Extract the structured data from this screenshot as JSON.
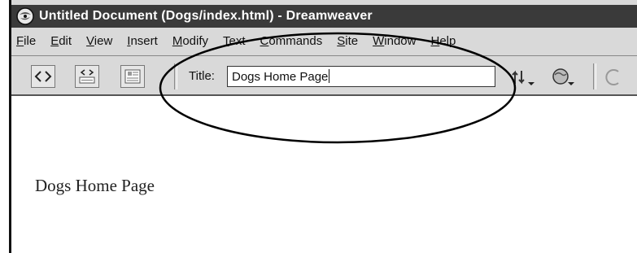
{
  "window": {
    "title": "Untitled Document (Dogs/index.html) - Dreamweaver"
  },
  "menubar": {
    "items": [
      {
        "first": "F",
        "rest": "ile"
      },
      {
        "first": "E",
        "rest": "dit"
      },
      {
        "first": "V",
        "rest": "iew"
      },
      {
        "first": "I",
        "rest": "nsert"
      },
      {
        "first": "M",
        "rest": "odify"
      },
      {
        "first": "T",
        "rest": "ext"
      },
      {
        "first": "C",
        "rest": "ommands"
      },
      {
        "first": "S",
        "rest": "ite"
      },
      {
        "first": "W",
        "rest": "indow"
      },
      {
        "first": "H",
        "rest": "elp"
      }
    ]
  },
  "toolbar": {
    "title_label": "Title:",
    "title_value": "Dogs Home Page"
  },
  "document": {
    "heading": "Dogs Home Page"
  },
  "colors": {
    "titlebar": "#3a3a3a",
    "chrome": "#d9d9d9"
  }
}
